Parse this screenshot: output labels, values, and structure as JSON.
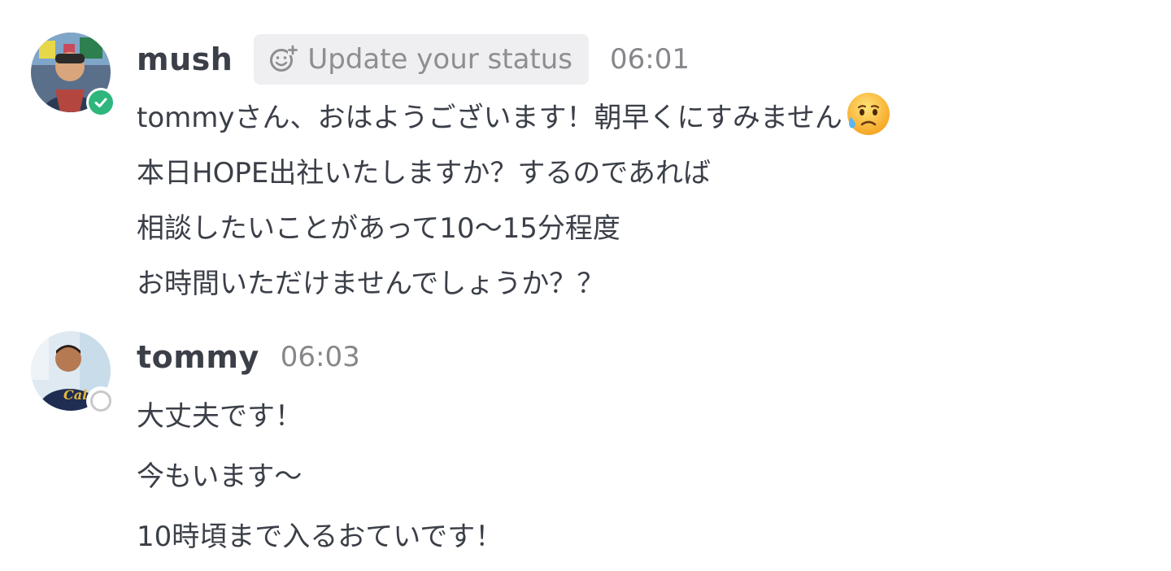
{
  "messages": [
    {
      "author": "mush",
      "status_button": "Update your status",
      "time": "06:01",
      "presence": "active",
      "lines": [
        "tommyさん、おはようございます！朝早くにすみません",
        "本日HOPE出社いたしますか？するのであれば",
        "相談したいことがあって10〜15分程度",
        "お時間いただけませんでしょうか？？"
      ],
      "emoji": "sad-but-relieved-face"
    },
    {
      "author": "tommy",
      "time": "06:03",
      "presence": "away",
      "lines": [
        "大丈夫です！",
        "今もいます〜",
        "10時頃まで入るおていです！"
      ]
    }
  ],
  "colors": {
    "presence_active": "#2eb67d",
    "presence_away": "#c9c9cc",
    "status_button_bg": "#efeff1"
  }
}
